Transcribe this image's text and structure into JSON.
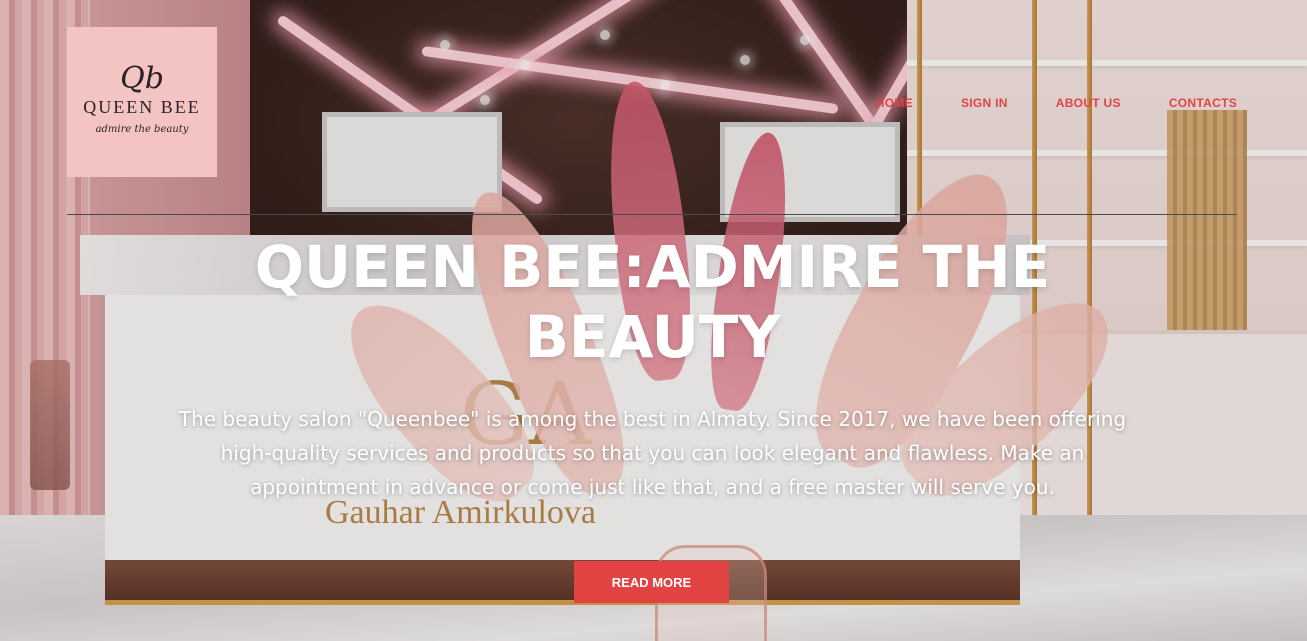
{
  "brand": {
    "monogram": "Qb",
    "name": "QUEEN BEE",
    "tagline": "admire the beauty"
  },
  "nav": {
    "items": [
      {
        "label": "HOME"
      },
      {
        "label": "SIGN IN"
      },
      {
        "label": "ABOUT US"
      },
      {
        "label": "CONTACTS"
      }
    ]
  },
  "hero": {
    "title": "QUEEN BEE:ADMIRE THE BEAUTY",
    "description": "The beauty salon \"Queenbee\" is among the best in Almaty. Since 2017, we have been offering high-quality services and products so that you can look elegant and flawless. Make an appointment in advance or come just like that, and a free master will serve you.",
    "button_label": "READ MORE"
  },
  "background_photo": {
    "desk_monogram": "GA",
    "desk_sign": "Gauhar Amirkulova"
  },
  "colors": {
    "accent": "#e14343",
    "logo_bg": "#f4c4c2",
    "nav_text": "#e04444"
  }
}
